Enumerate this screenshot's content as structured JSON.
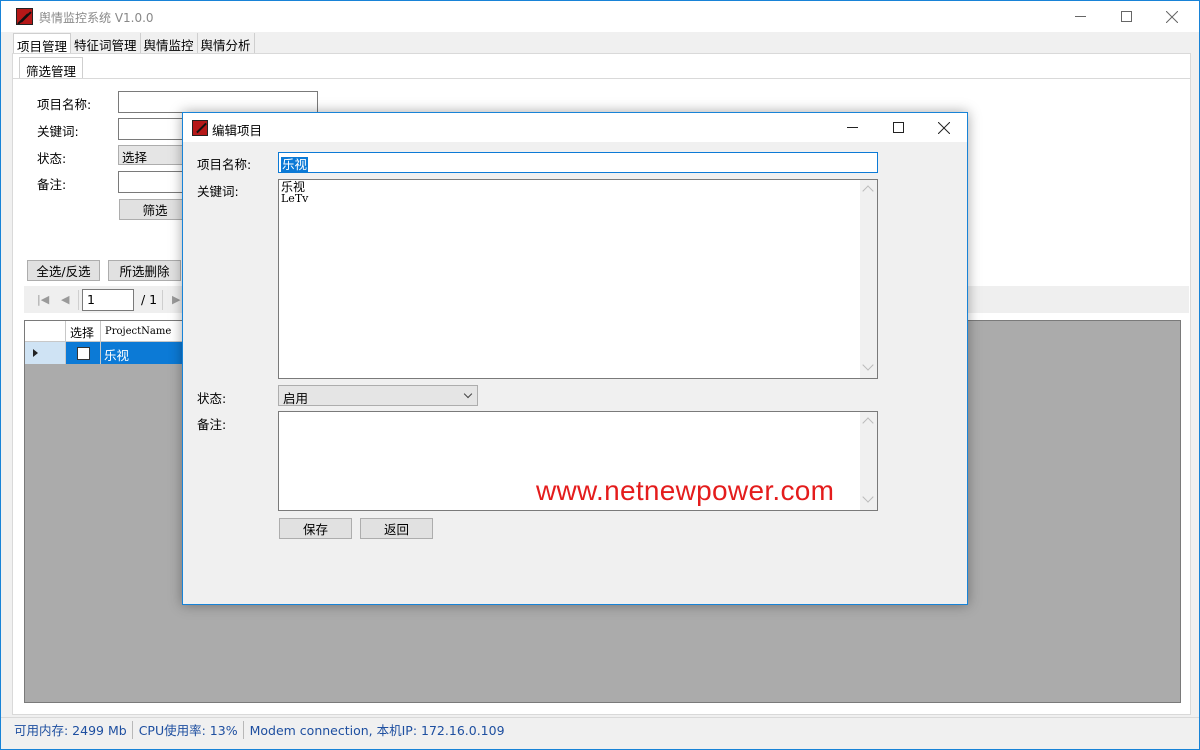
{
  "window": {
    "title": "舆情监控系统 V1.0.0"
  },
  "menu": {
    "tabs": [
      "项目管理",
      "特征词管理",
      "舆情监控",
      "舆情分析"
    ]
  },
  "subtab": {
    "label": "筛选管理"
  },
  "filter": {
    "name_label": "项目名称:",
    "keyword_label": "关键词:",
    "status_label": "状态:",
    "status_value": "选择",
    "note_label": "备注:",
    "filter_button": "筛选"
  },
  "actions": {
    "select_all": "全选/反选",
    "delete_selected": "所选删除"
  },
  "pager": {
    "current_page": "1",
    "total_label": "/ 1"
  },
  "grid": {
    "columns": [
      "选择",
      "ProjectName"
    ],
    "rows": [
      {
        "selected": false,
        "project_name": "乐视"
      }
    ]
  },
  "statusbar": {
    "memory": "可用内存: 2499 Mb",
    "cpu": "CPU使用率: 13%",
    "network": "Modem connection, 本机IP: 172.16.0.109"
  },
  "dialog": {
    "title": "编辑项目",
    "name_label": "项目名称:",
    "name_value": "乐视",
    "keyword_label": "关键词:",
    "keywords": [
      "乐视",
      "LeTv"
    ],
    "status_label": "状态:",
    "status_value": "启用",
    "note_label": "备注:",
    "note_value": "",
    "save_button": "保存",
    "back_button": "返回",
    "watermark": "www.netnewpower.com"
  },
  "colors": {
    "accent": "#0c7ad6",
    "window_border": "#1883d7",
    "status_text": "#1e4fa0",
    "watermark": "#e41c1c"
  },
  "icons": {
    "app": "app-logo-icon",
    "minimize": "minimize-icon",
    "maximize": "maximize-icon",
    "close": "close-icon",
    "first_page": "first-page-icon",
    "prev_page": "prev-page-icon",
    "next_page": "next-page-icon"
  }
}
